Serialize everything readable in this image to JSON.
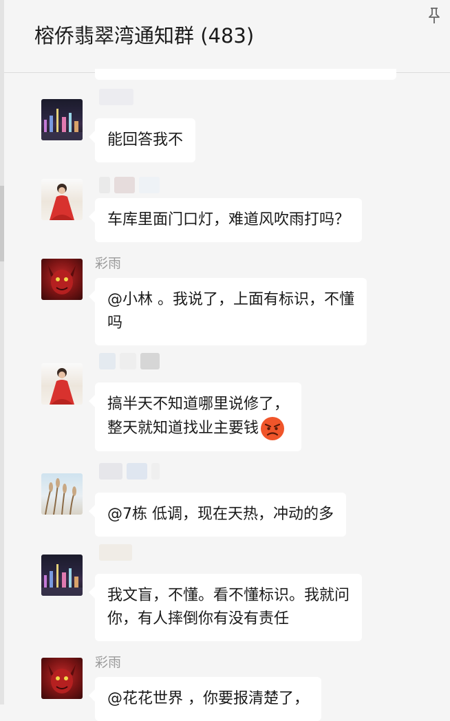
{
  "header": {
    "title": "榕侨翡翠湾通知群 (483)"
  },
  "icons": {
    "pin": "pin-icon",
    "emoji_angry": "angry-face-icon"
  },
  "messages": [
    {
      "sender": "",
      "avatar": "city-night-avatar",
      "lines": [
        "能回答我不"
      ]
    },
    {
      "sender": "",
      "avatar": "woman-red-dress-avatar",
      "lines": [
        "车库里面门口灯，难道风吹雨打吗？"
      ]
    },
    {
      "sender": "彩雨",
      "avatar": "red-devil-avatar",
      "lines": [
        "@小林 。我说了，上面有标识，不懂",
        "吗"
      ]
    },
    {
      "sender": "",
      "avatar": "woman-red-dress-avatar",
      "lines": [
        "搞半天不知道哪里说修了，",
        "整天就知道找业主要钱"
      ]
    },
    {
      "sender": "",
      "avatar": "reeds-avatar",
      "lines": [
        "@7栋 低调，现在天热，冲动的多"
      ]
    },
    {
      "sender": "",
      "avatar": "city-night-avatar",
      "lines": [
        "我文盲，不懂。看不懂标识。我就问",
        "你，有人摔倒你有没有责任"
      ]
    },
    {
      "sender": "彩雨",
      "avatar": "red-devil-avatar",
      "lines": [
        "@花花世界 ，你要报清楚了，"
      ]
    }
  ]
}
